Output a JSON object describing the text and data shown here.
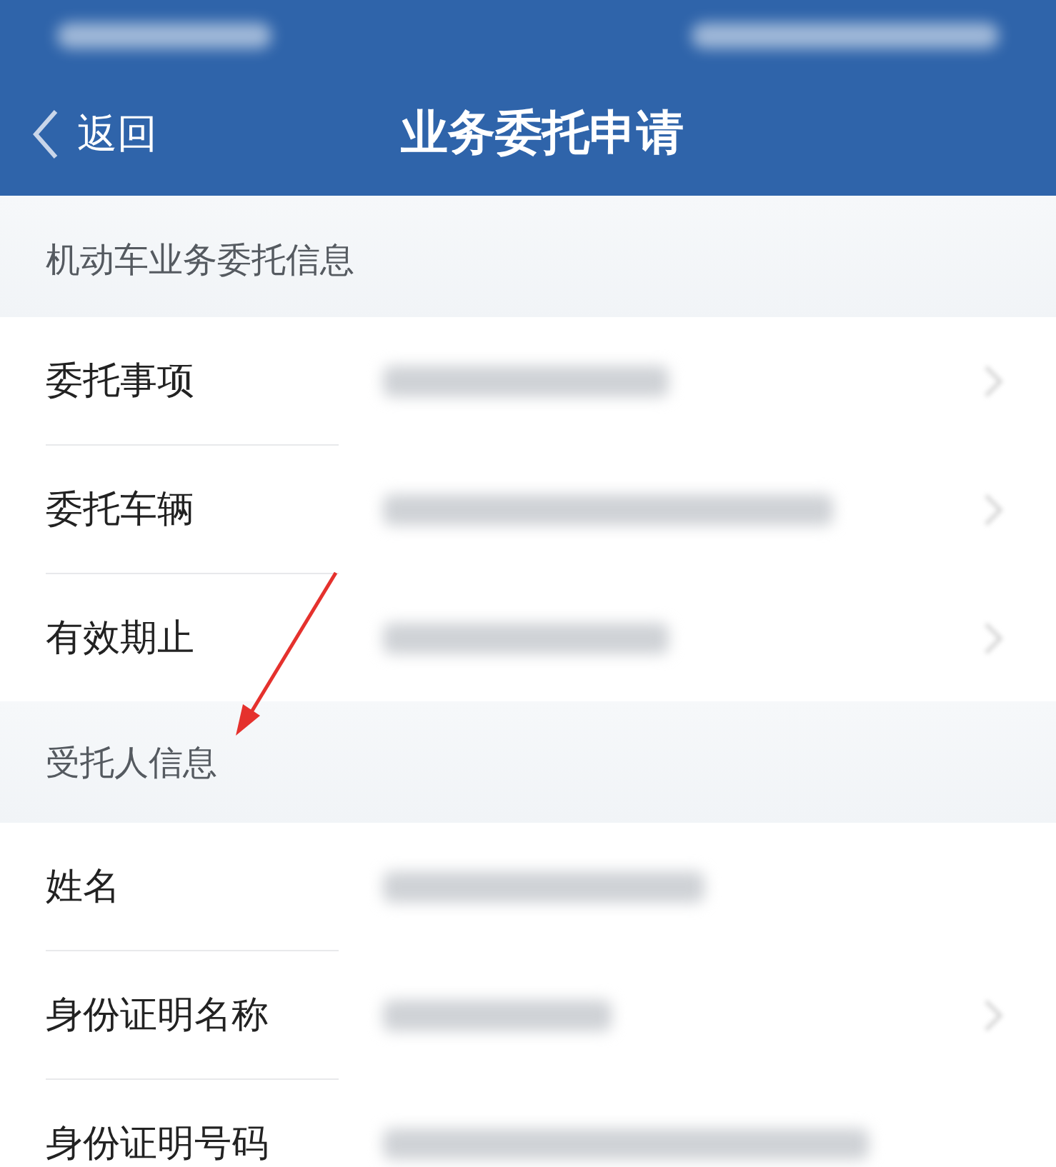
{
  "nav": {
    "back_label": "返回",
    "title": "业务委托申请"
  },
  "sections": [
    {
      "title": "机动车业务委托信息",
      "rows": [
        {
          "label": "委托事项",
          "kind": "select"
        },
        {
          "label": "委托车辆",
          "kind": "select"
        },
        {
          "label": "有效期止",
          "kind": "select"
        }
      ]
    },
    {
      "title": "受托人信息",
      "rows": [
        {
          "label": "姓名",
          "kind": "input"
        },
        {
          "label": "身份证明名称",
          "kind": "select"
        },
        {
          "label": "身份证明号码",
          "kind": "input"
        }
      ]
    }
  ]
}
